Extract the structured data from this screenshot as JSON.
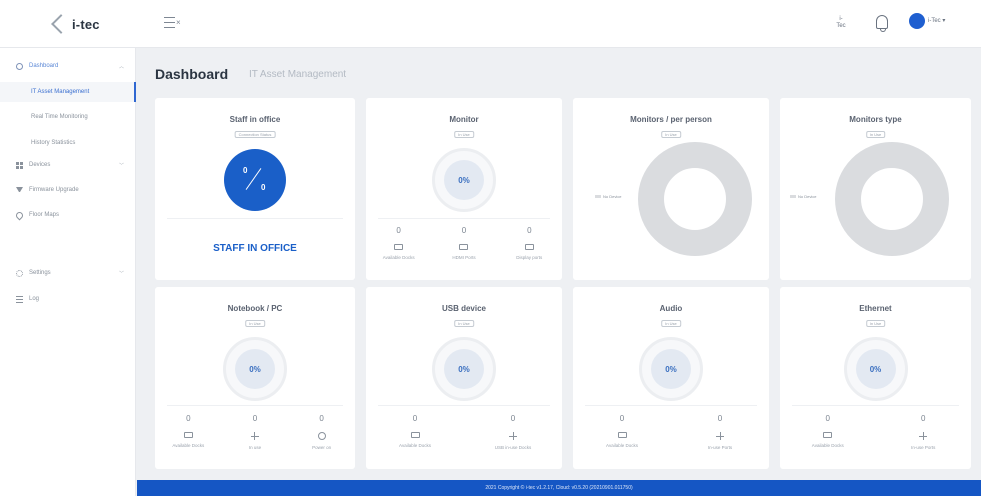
{
  "header": {
    "logo_text": "i-tec",
    "tec_label_line1": "i-",
    "tec_label_line2": "Tec",
    "user_name": "i-Tec"
  },
  "sidebar": {
    "items": [
      {
        "label": "Dashboard",
        "icon": "dashboard-icon"
      },
      {
        "label": "IT Asset Management"
      },
      {
        "label": "Real Time Monitoring"
      },
      {
        "label": "History Statistics"
      },
      {
        "label": "Devices",
        "icon": "grid-icon"
      },
      {
        "label": "Firmware Upgrade",
        "icon": "download-icon"
      },
      {
        "label": "Floor Maps",
        "icon": "pin-icon"
      },
      {
        "label": "Settings",
        "icon": "gear-icon"
      },
      {
        "label": "Log",
        "icon": "list-icon"
      }
    ]
  },
  "page": {
    "title": "Dashboard",
    "subtitle": "IT Asset Management"
  },
  "cards": {
    "staff": {
      "title": "Staff in office",
      "badge": "Connection Status",
      "current": "0",
      "total": "0",
      "label": "STAFF IN OFFICE",
      "accent": "#1a5fc8"
    },
    "monitor": {
      "title": "Monitor",
      "badge": "In Use",
      "percent": "0%",
      "stats": [
        {
          "value": "0",
          "label": "Available Docks",
          "icon": "monitor-icon"
        },
        {
          "value": "0",
          "label": "HDMI Ports",
          "icon": "monitor-icon"
        },
        {
          "value": "0",
          "label": "Display ports",
          "icon": "monitor-icon"
        }
      ]
    },
    "monitors_per_person": {
      "title": "Monitors / per person",
      "badge": "In Use",
      "legend": "No Device"
    },
    "monitors_type": {
      "title": "Monitors type",
      "badge": "In Use",
      "legend": "No Device"
    },
    "notebook": {
      "title": "Notebook / PC",
      "badge": "In Use",
      "percent": "0%",
      "stats": [
        {
          "value": "0",
          "label": "Available Docks",
          "icon": "dock-icon"
        },
        {
          "value": "0",
          "label": "In use",
          "icon": "usb-icon"
        },
        {
          "value": "0",
          "label": "Power on",
          "icon": "power-icon"
        }
      ]
    },
    "usb": {
      "title": "USB device",
      "badge": "In Use",
      "percent": "0%",
      "stats": [
        {
          "value": "0",
          "label": "Available Docks",
          "icon": "dock-icon"
        },
        {
          "value": "0",
          "label": "USB in-use Docks",
          "icon": "usb-icon"
        }
      ]
    },
    "audio": {
      "title": "Audio",
      "badge": "In Use",
      "percent": "0%",
      "stats": [
        {
          "value": "0",
          "label": "Available Docks",
          "icon": "dock-icon"
        },
        {
          "value": "0",
          "label": "In-use Ports",
          "icon": "usb-icon"
        }
      ]
    },
    "ethernet": {
      "title": "Ethernet",
      "badge": "In Use",
      "percent": "0%",
      "stats": [
        {
          "value": "0",
          "label": "Available Docks",
          "icon": "dock-icon"
        },
        {
          "value": "0",
          "label": "In-use Ports",
          "icon": "usb-icon"
        }
      ]
    }
  },
  "footer": {
    "text": "2021 Copyright © i-tec v1.2.17, Cloud: v0.5.20 (20210901.011750)"
  },
  "colors": {
    "primary": "#1556c4",
    "donut": "#dadcdf"
  }
}
